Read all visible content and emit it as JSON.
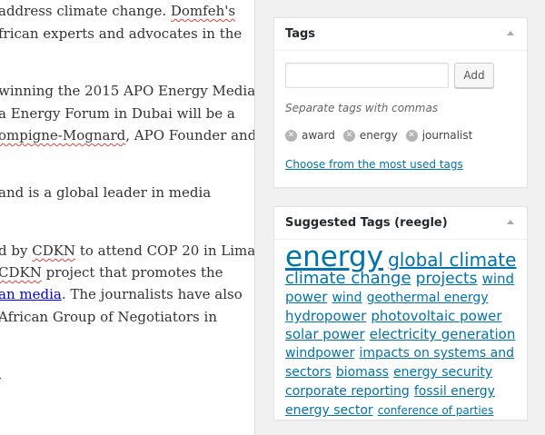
{
  "editor": {
    "lines": [
      {
        "segments": [
          {
            "text": "address climate change. ",
            "style": "plain"
          },
          {
            "text": "Domfeh's",
            "style": "spell"
          }
        ]
      },
      {
        "segments": [
          {
            "text": "frican experts and advocates in the",
            "style": "plain"
          }
        ]
      },
      {
        "segments": [
          {
            "text": "winning the 2015 APO Energy Media",
            "style": "plain"
          }
        ]
      },
      {
        "segments": [
          {
            "text": "a Energy Forum in Dubai will be a",
            "style": "plain"
          }
        ]
      },
      {
        "segments": [
          {
            "text": "ompigne-Mognard",
            "style": "spell"
          },
          {
            "text": ", APO Founder and",
            "style": "plain"
          }
        ]
      },
      {
        "segments": [
          {
            "text": " and is a global leader in media",
            "style": "plain"
          }
        ]
      },
      {
        "segments": [
          {
            "text": "d by ",
            "style": "plain"
          },
          {
            "text": "CDKN",
            "style": "spell"
          },
          {
            "text": " to attend COP 20 in Lima,",
            "style": "plain"
          }
        ]
      },
      {
        "segments": [
          {
            "text": "CDKN",
            "style": "spell"
          },
          {
            "text": " project that promotes the",
            "style": "plain"
          }
        ]
      },
      {
        "segments": [
          {
            "text": "an media",
            "style": "link"
          },
          {
            "text": ". The journalists have also",
            "style": "plain"
          }
        ]
      },
      {
        "segments": [
          {
            "text": "African Group of Negotiators in",
            "style": "plain"
          }
        ]
      },
      {
        "segments": [
          {
            "text": "",
            "style": "link"
          }
        ]
      }
    ]
  },
  "tags_box": {
    "title": "Tags",
    "input_value": "",
    "input_placeholder": "",
    "add_label": "Add",
    "hint": "Separate tags with commas",
    "remove_glyph": "✕",
    "tags": [
      "award",
      "energy",
      "journalist"
    ],
    "most_used_link": "Choose from the most used tags"
  },
  "suggested_box": {
    "title": "Suggested Tags (reegle)",
    "tags": [
      {
        "label": "energy",
        "size": 31
      },
      {
        "label": "global climate",
        "size": 20
      },
      {
        "label": "climate change",
        "size": 18
      },
      {
        "label": "projects",
        "size": 17
      },
      {
        "label": "wind",
        "size": 15
      },
      {
        "label": "power",
        "size": 15
      },
      {
        "label": "wind",
        "size": 14
      },
      {
        "label": "geothermal energy",
        "size": 14
      },
      {
        "label": "hydropower",
        "size": 15
      },
      {
        "label": "photovoltaic power",
        "size": 15
      },
      {
        "label": "solar power",
        "size": 15
      },
      {
        "label": "electricity generation",
        "size": 15
      },
      {
        "label": "windpower",
        "size": 14
      },
      {
        "label": "impacts on systems and",
        "size": 14
      },
      {
        "label": "sectors",
        "size": 14
      },
      {
        "label": "biomass",
        "size": 14
      },
      {
        "label": "energy security",
        "size": 14
      },
      {
        "label": "corporate reporting",
        "size": 14
      },
      {
        "label": "fossil energy",
        "size": 14
      },
      {
        "label": "energy sector",
        "size": 14
      },
      {
        "label": "conference of parties",
        "size": 12
      }
    ]
  },
  "colors": {
    "link": "#0073aa",
    "spellcheck": "#e04040",
    "background": "#f1f1f1"
  }
}
